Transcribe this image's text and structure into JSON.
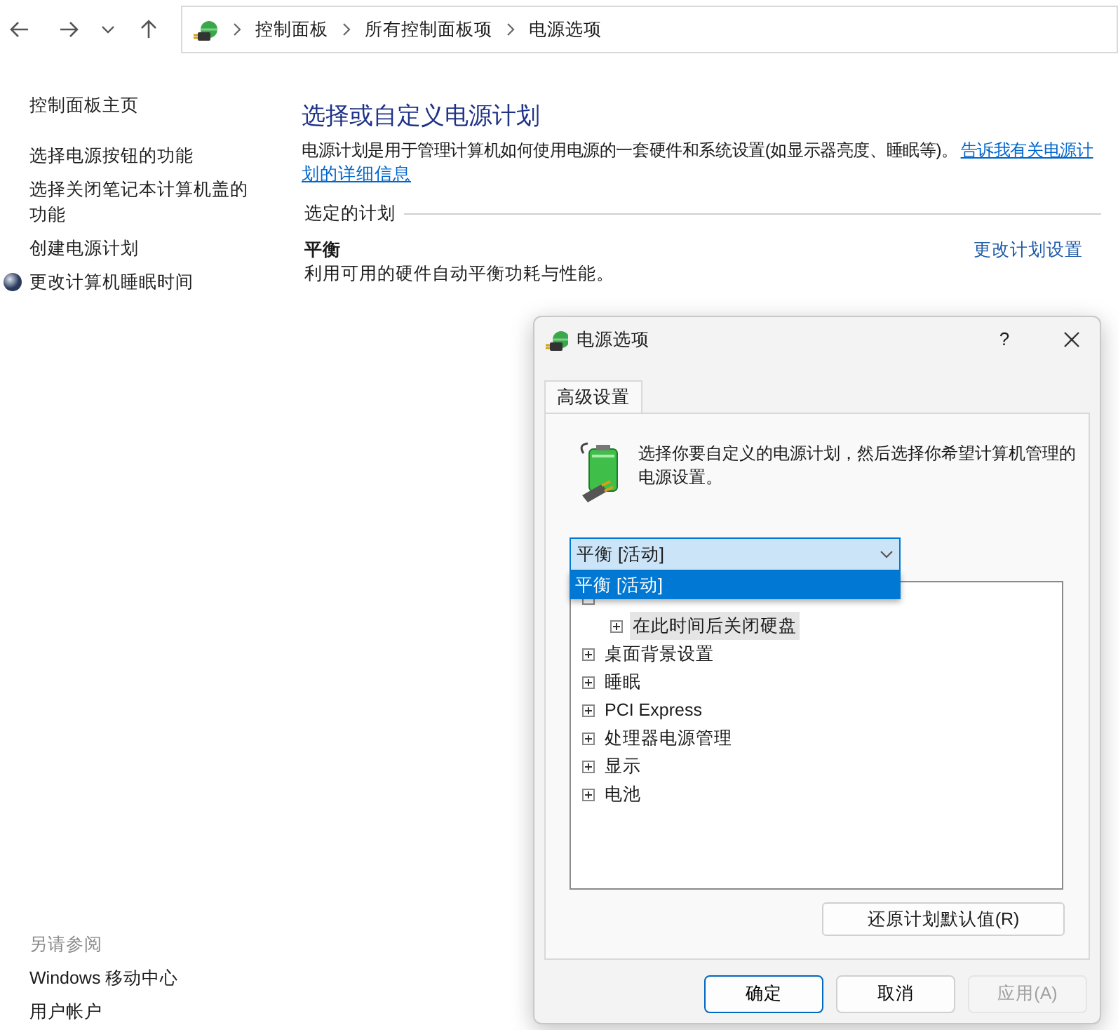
{
  "breadcrumb": [
    "控制面板",
    "所有控制面板项",
    "电源选项"
  ],
  "sidebar": {
    "items": [
      {
        "label": "控制面板主页",
        "kind": "link"
      },
      {
        "label": "选择电源按钮的功能",
        "kind": "link"
      },
      {
        "label": "选择关闭笔记本计算机盖的功能",
        "kind": "link"
      },
      {
        "label": "创建电源计划",
        "kind": "link"
      },
      {
        "label": "更改计算机睡眠时间",
        "kind": "icon-link"
      }
    ],
    "see_also_title": "另请参阅",
    "see_also": [
      "Windows 移动中心",
      "用户帐户"
    ]
  },
  "main": {
    "title": "选择或自定义电源计划",
    "description": "电源计划是用于管理计算机如何使用电源的一套硬件和系统设置(如显示器亮度、睡眠等)。",
    "info_link_lines": [
      "告诉我有关电源计",
      "划的详细信息"
    ],
    "section_label": "选定的计划",
    "plan_name": "平衡",
    "plan_description": "利用可用的硬件自动平衡功耗与性能。",
    "change_link": "更改计划设置"
  },
  "dialog": {
    "title": "电源选项",
    "help": "?",
    "tabs": [
      {
        "label": "高级设置",
        "selected": true
      }
    ],
    "intro": "选择你要自定义的电源计划，然后选择你希望计算机管理的电源设置。",
    "plan_select": {
      "value": "平衡 [活动]",
      "expanded": true,
      "options": [
        {
          "label": "平衡 [活动]",
          "selected": true
        }
      ]
    },
    "tree": [
      {
        "expanded": true,
        "children": [
          {
            "label": "在此时间后关闭硬盘",
            "expanded": false,
            "selected": true
          }
        ]
      },
      {
        "label": "桌面背景设置",
        "expanded": false,
        "selected": false
      },
      {
        "label": "睡眠",
        "expanded": false,
        "selected": false
      },
      {
        "label": "PCI Express",
        "expanded": false,
        "selected": false
      },
      {
        "label": "处理器电源管理",
        "expanded": false,
        "selected": false
      },
      {
        "label": "显示",
        "expanded": false,
        "selected": false
      },
      {
        "label": "电池",
        "expanded": false,
        "selected": false
      }
    ],
    "restore_button": "还原计划默认值(R)",
    "buttons": [
      {
        "label": "确定",
        "kind": "default",
        "disabled": false
      },
      {
        "label": "取消",
        "kind": "normal",
        "disabled": false
      },
      {
        "label": "应用(A)",
        "kind": "normal",
        "disabled": true
      }
    ]
  }
}
